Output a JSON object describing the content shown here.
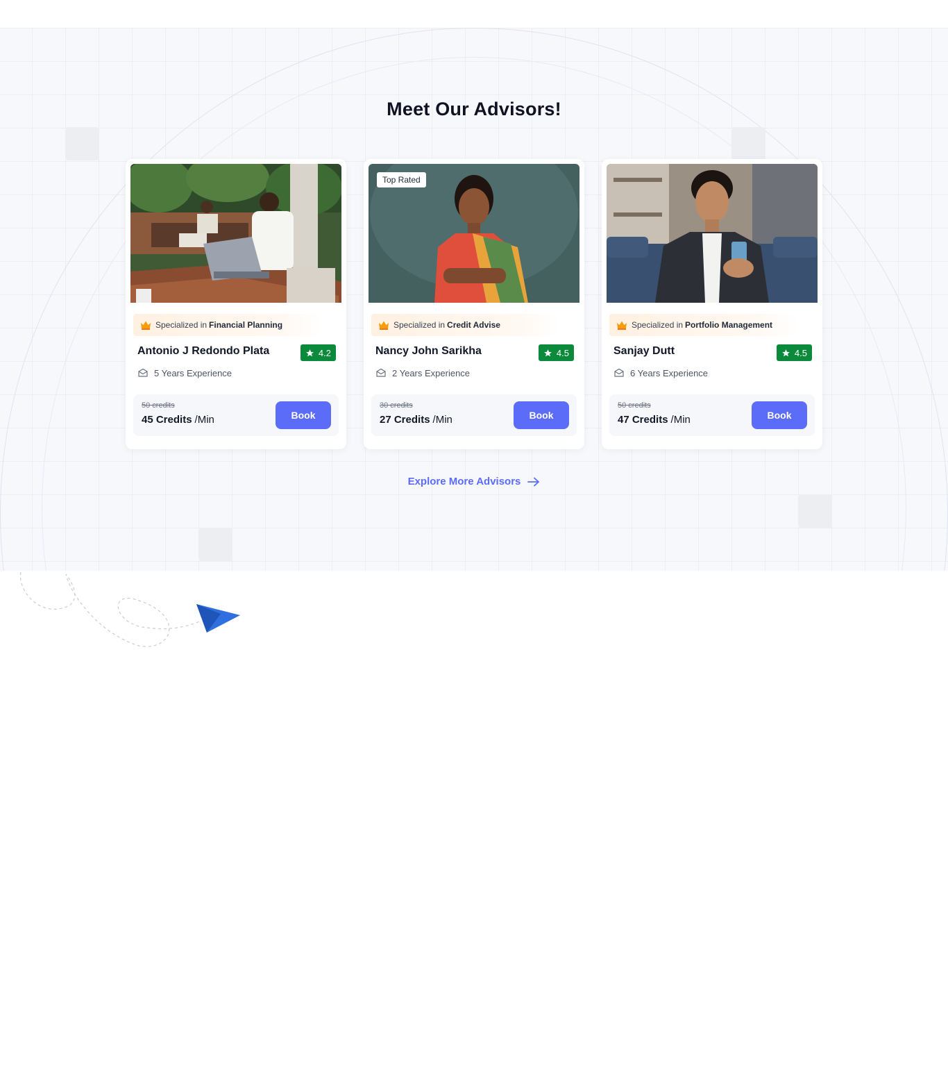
{
  "section": {
    "title": "Meet Our Advisors!",
    "explore_link": "Explore More Advisors"
  },
  "colors": {
    "accent": "#5b6cf9",
    "rating_green": "#0a8a3a",
    "crown_orange": "#f59e0b"
  },
  "advisors": [
    {
      "badge": "",
      "specialized_prefix": "Specialized in",
      "specialization": "Financial Planning",
      "name": "Antonio J Redondo Plata",
      "rating": "4.2",
      "experience": "5 Years Experience",
      "old_price": "50 credits",
      "price": "45 Credits",
      "price_unit": "/Min",
      "book_label": "Book"
    },
    {
      "badge": "Top Rated",
      "specialized_prefix": "Specialized in",
      "specialization": "Credit Advise",
      "name": "Nancy John Sarikha",
      "rating": "4.5",
      "experience": "2 Years Experience",
      "old_price": "30 credits",
      "price": "27 Credits",
      "price_unit": "/Min",
      "book_label": "Book"
    },
    {
      "badge": "",
      "specialized_prefix": "Specialized in",
      "specialization": "Portfolio Management",
      "name": "Sanjay Dutt",
      "rating": "4.5",
      "experience": "6 Years Experience",
      "old_price": "50 credits",
      "price": "47 Credits",
      "price_unit": "/Min",
      "book_label": "Book"
    }
  ]
}
